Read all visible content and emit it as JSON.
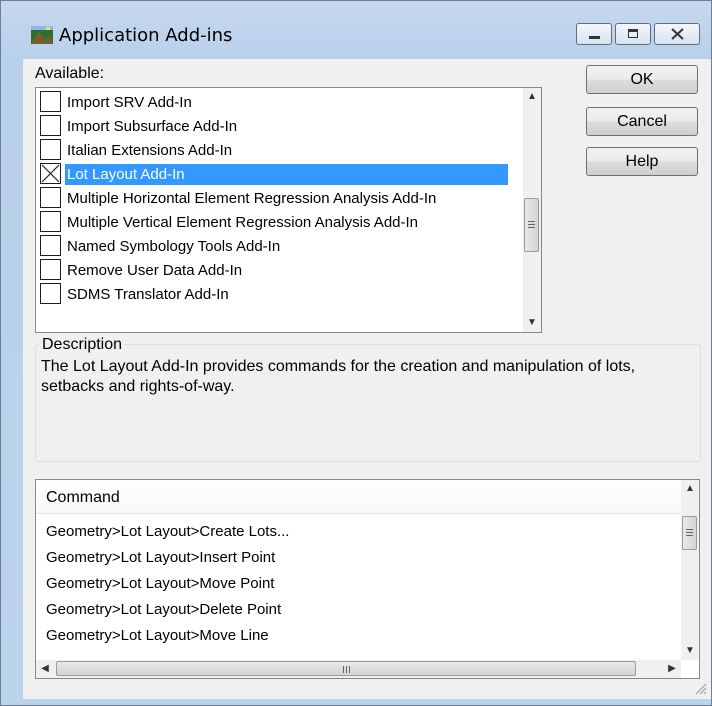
{
  "window": {
    "title": "Application Add-ins"
  },
  "available": {
    "label": "Available:",
    "items": [
      {
        "label": "Import SRV Add-In",
        "checked": false,
        "selected": false
      },
      {
        "label": "Import Subsurface Add-In",
        "checked": false,
        "selected": false
      },
      {
        "label": "Italian Extensions Add-In",
        "checked": false,
        "selected": false
      },
      {
        "label": "Lot Layout Add-In",
        "checked": true,
        "selected": true
      },
      {
        "label": "Multiple Horizontal Element Regression Analysis Add-In",
        "checked": false,
        "selected": false
      },
      {
        "label": "Multiple Vertical Element Regression Analysis Add-In",
        "checked": false,
        "selected": false
      },
      {
        "label": "Named Symbology Tools Add-In",
        "checked": false,
        "selected": false
      },
      {
        "label": "Remove User Data Add-In",
        "checked": false,
        "selected": false
      },
      {
        "label": "SDMS Translator Add-In",
        "checked": false,
        "selected": false
      }
    ]
  },
  "buttons": {
    "ok": "OK",
    "cancel": "Cancel",
    "help": "Help"
  },
  "description": {
    "title": "Description",
    "text": "The Lot Layout Add-In provides commands for the creation and manipulation of lots, setbacks and rights-of-way."
  },
  "commands": {
    "header": "Command",
    "rows": [
      "Geometry>Lot Layout>Create Lots...",
      "Geometry>Lot Layout>Insert Point",
      "Geometry>Lot Layout>Move Point",
      "Geometry>Lot Layout>Delete Point",
      "Geometry>Lot Layout>Move Line"
    ]
  },
  "icons": {
    "app": "add-ins-app-icon",
    "minimize": "minimize-icon",
    "maximize": "maximize-icon",
    "close": "close-icon"
  }
}
